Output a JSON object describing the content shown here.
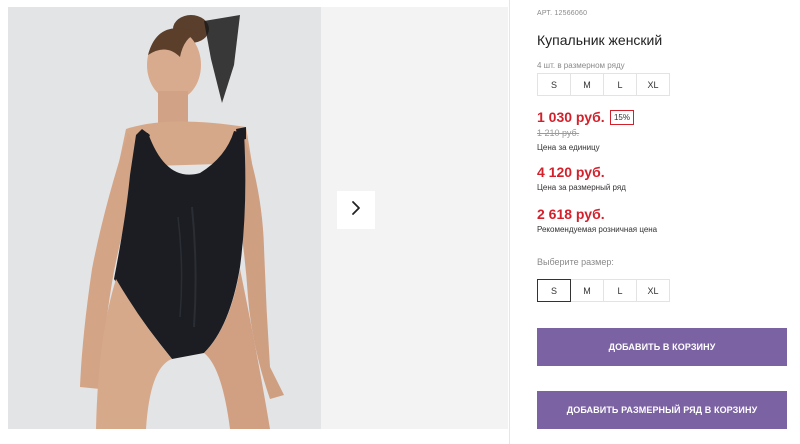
{
  "product": {
    "sku": "АРТ. 12566060",
    "title": "Купальник женский",
    "range_note": "4 шт. в размерном ряду",
    "range_sizes": [
      "S",
      "M",
      "L",
      "XL"
    ]
  },
  "pricing": {
    "unit_price": "1 030 руб.",
    "discount_badge": "15%",
    "old_price": "1 210 руб.",
    "unit_caption": "Цена за единицу",
    "range_price": "4 120 руб.",
    "range_caption": "Цена за размерный ряд",
    "retail_price": "2 618 руб.",
    "retail_caption": "Рекомендуемая розничная цена"
  },
  "size_select": {
    "label": "Выберите размер:",
    "options": [
      "S",
      "M",
      "L",
      "XL"
    ],
    "selected": "S"
  },
  "actions": {
    "add_to_cart": "Добавить в корзину",
    "add_range_to_cart": "Добавить размерный ряд в корзину"
  },
  "gallery": {
    "next_icon": "chevron-right-icon"
  },
  "colors": {
    "price_red": "#d3212c",
    "button_purple": "#7b62a3",
    "swimsuit": "#1b1d22",
    "skin": "#d8a98c"
  }
}
